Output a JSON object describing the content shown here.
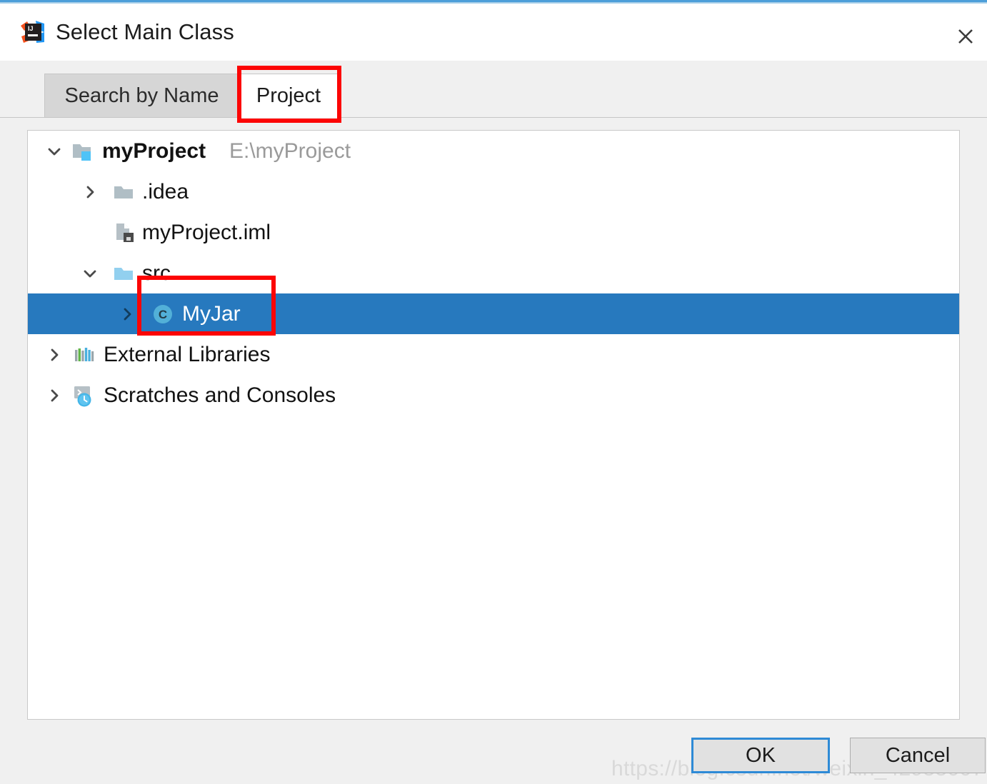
{
  "window": {
    "title": "Select Main Class",
    "app_icon": "intellij-idea-logo-icon",
    "close_icon": "close-icon",
    "accent_color": "#4c9ed9",
    "background_color": "#f0f0f0"
  },
  "tabs": [
    {
      "label": "Search by Name",
      "active": false
    },
    {
      "label": "Project",
      "active": true
    }
  ],
  "tree": {
    "nodes": [
      {
        "label": "myProject",
        "path_suffix": "E:\\myProject",
        "icon": "module-folder-icon",
        "chevron": "chevron-down-icon",
        "expanded": true,
        "selected": false,
        "bold": true,
        "depth": 0
      },
      {
        "label": ".idea",
        "path_suffix": "",
        "icon": "folder-icon",
        "chevron": "chevron-right-icon",
        "expanded": false,
        "selected": false,
        "bold": false,
        "depth": 1
      },
      {
        "label": "myProject.iml",
        "path_suffix": "",
        "icon": "iml-file-icon",
        "chevron": "",
        "expanded": false,
        "selected": false,
        "bold": false,
        "depth": 2
      },
      {
        "label": "src",
        "path_suffix": "",
        "icon": "source-folder-icon",
        "chevron": "chevron-down-icon",
        "expanded": true,
        "selected": false,
        "bold": false,
        "depth": 1
      },
      {
        "label": "MyJar",
        "path_suffix": "",
        "icon": "java-class-icon",
        "chevron": "chevron-right-icon",
        "expanded": false,
        "selected": true,
        "bold": false,
        "depth": 2
      },
      {
        "label": "External Libraries",
        "path_suffix": "",
        "icon": "external-libraries-icon",
        "chevron": "chevron-right-icon",
        "expanded": false,
        "selected": false,
        "bold": false,
        "depth": 0
      },
      {
        "label": "Scratches and Consoles",
        "path_suffix": "",
        "icon": "scratches-consoles-icon",
        "chevron": "chevron-right-icon",
        "expanded": false,
        "selected": false,
        "bold": false,
        "depth": 0
      }
    ],
    "selection_color": "#2779be"
  },
  "footer": {
    "ok_label": "OK",
    "cancel_label": "Cancel",
    "default_button": "OK"
  },
  "annotations": {
    "color": "#fc0505",
    "boxes": [
      {
        "target": "Project"
      },
      {
        "target": "MyJar"
      }
    ]
  },
  "watermark": {
    "text": "https://blog.csdn.net/weixin_42955007"
  }
}
